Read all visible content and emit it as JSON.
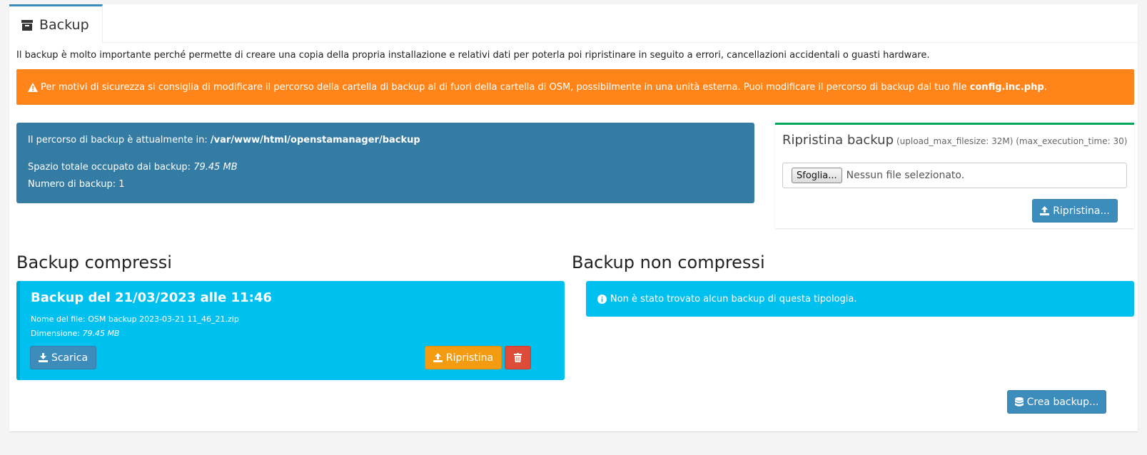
{
  "tab": {
    "label": "Backup",
    "icon": "archive-icon"
  },
  "intro": "Il backup è molto importante perché permette di creare una copia della propria installazione e relativi dati per poterla poi ripristinare in seguito a errori, cancellazioni accidentali o guasti hardware.",
  "warning": {
    "icon": "warning-icon",
    "text_before": "Per motivi di sicurezza si consiglia di modificare il percorso della cartella di backup al di fuori della cartella di OSM, possibilmente in una unità esterna. Puoi modificare il percorso di backup dal tuo file ",
    "file": "config.inc.php",
    "text_after": ".",
    "color": "#ff851b"
  },
  "info": {
    "path_label": "Il percorso di backup è attualmente in: ",
    "path": "/var/www/html/openstamanager/backup",
    "space_label": "Spazio totale occupato dai backup: ",
    "space": "79.45 MB",
    "count_label": "Numero di backup: 1"
  },
  "restore": {
    "title": "Ripristina backup",
    "limits": "(upload_max_filesize: 32M) (max_execution_time: 30)",
    "browse_label": "Sfoglia...",
    "no_file": "Nessun file selezionato.",
    "button": "Ripristina..."
  },
  "compressed": {
    "title": "Backup compressi",
    "items": [
      {
        "heading": "Backup del 21/03/2023 alle 11:46",
        "filename_label": "Nome del file: ",
        "filename": "OSM backup 2023-03-21 11_46_21.zip",
        "size_label": "Dimensione: ",
        "size": "79.45 MB",
        "download": "Scarica",
        "restore": "Ripristina"
      }
    ]
  },
  "uncompressed": {
    "title": "Backup non compressi",
    "empty": "Non è stato trovato alcun backup di questa tipologia."
  },
  "create_button": "Crea backup...",
  "colors": {
    "primary": "#3c8dbc",
    "info_box": "#357ca5",
    "cyan": "#00c0ef",
    "success": "#00a65a",
    "warning_btn": "#f39c12",
    "danger": "#dd4b39"
  }
}
